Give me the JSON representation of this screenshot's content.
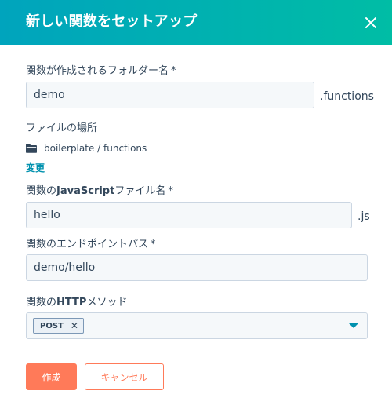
{
  "dialog": {
    "title": "新しい関数をセットアップ",
    "close_icon": "close-icon"
  },
  "folder_name": {
    "label": "関数が作成されるフォルダー名",
    "required_mark": "*",
    "value": "demo",
    "suffix": ".functions"
  },
  "file_location": {
    "label": "ファイルの場所",
    "icon": "folder-icon",
    "path": "boilerplate / functions",
    "change_link": "変更"
  },
  "js_file_name": {
    "label_prefix": "関数の",
    "label_bold": "JavaScript",
    "label_suffix": "ファイル名",
    "required_mark": "*",
    "value": "hello",
    "suffix": ".js"
  },
  "endpoint_path": {
    "label": "関数のエンドポイントパス",
    "required_mark": "*",
    "value": "demo/hello"
  },
  "http_method": {
    "label_prefix": "関数の",
    "label_bold": "HTTP",
    "label_suffix": "メソッド",
    "selected_tag": "POST",
    "remove_glyph": "✕",
    "caret_icon": "caret-down-icon"
  },
  "buttons": {
    "create": "作成",
    "cancel": "キャンセル"
  },
  "colors": {
    "header_gradient_start": "#00a4bd",
    "header_gradient_end": "#00bda5",
    "primary": "#ff7a59",
    "link": "#0091ae"
  }
}
